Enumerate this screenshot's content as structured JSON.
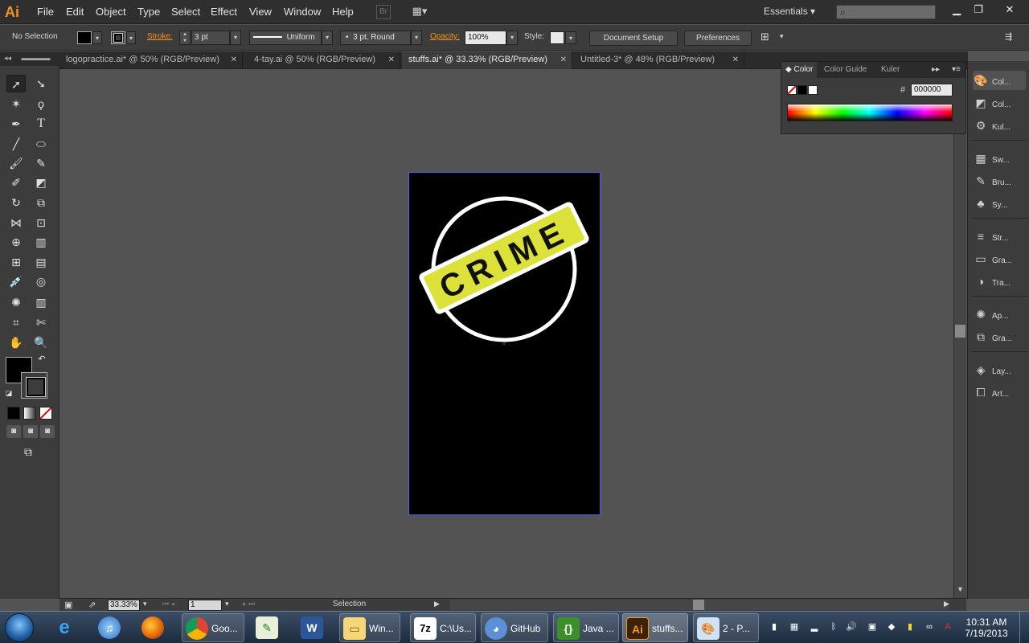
{
  "app": {
    "logo": "Ai",
    "workspace": "Essentials"
  },
  "menu": [
    "File",
    "Edit",
    "Object",
    "Type",
    "Select",
    "Effect",
    "View",
    "Window",
    "Help"
  ],
  "menubar_icons": {
    "bridge": "Br",
    "arrange": "arrange-documents-icon"
  },
  "control": {
    "selection": "No Selection",
    "stroke_label": "Stroke:",
    "stroke_weight": "3 pt",
    "profile": "Uniform",
    "brush": "3 pt. Round",
    "opacity_label": "Opacity:",
    "opacity": "100%",
    "style_label": "Style:",
    "doc_setup": "Document Setup",
    "preferences": "Preferences"
  },
  "tabs": [
    {
      "label": "logopractice.ai* @ 50% (RGB/Preview)",
      "active": false
    },
    {
      "label": "4-tay.ai @ 50% (RGB/Preview)",
      "active": false
    },
    {
      "label": "stuffs.ai* @ 33.33% (RGB/Preview)",
      "active": true
    },
    {
      "label": "Untitled-3* @ 48% (RGB/Preview)",
      "active": false
    }
  ],
  "artwork": {
    "text": "CRIME",
    "badge_color": "#dce23a",
    "ring_color": "#ffffff"
  },
  "color_panel": {
    "tabs": [
      "Color",
      "Color Guide",
      "Kuler"
    ],
    "hash": "#",
    "hex": "000000"
  },
  "dock": [
    "Col...",
    "Col...",
    "Kul...",
    "Sw...",
    "Bru...",
    "Sy...",
    "Str...",
    "Gra...",
    "Tra...",
    "Ap...",
    "Gra...",
    "Lay...",
    "Art..."
  ],
  "status": {
    "zoom": "33.33%",
    "artboard": "1",
    "tool": "Selection"
  },
  "taskbar": {
    "items": [
      "Goo...",
      "Win...",
      "C:\\Us...",
      "GitHub",
      "Java ...",
      "stuffs...",
      "2 - P..."
    ],
    "time": "10:31 AM",
    "date": "7/19/2013"
  }
}
